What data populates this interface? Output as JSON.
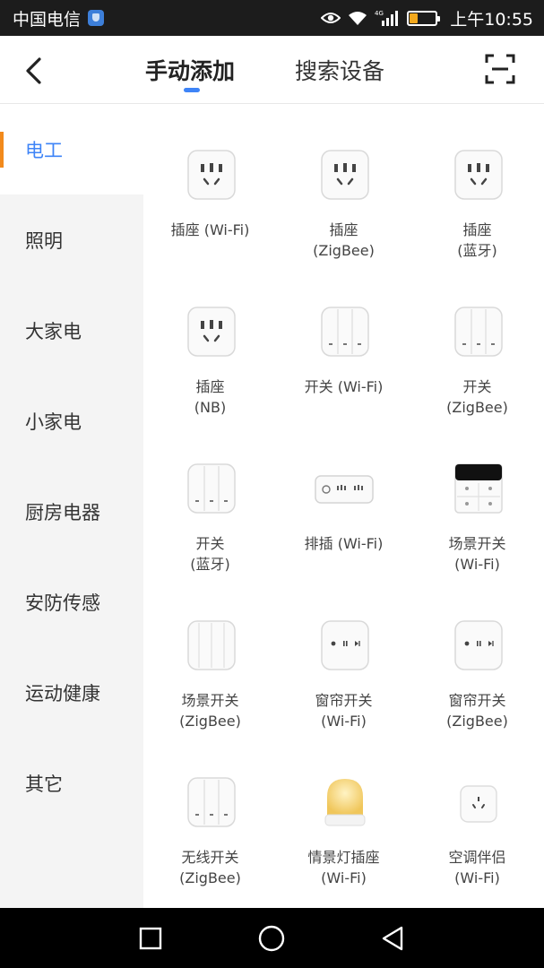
{
  "status_bar": {
    "carrier": "中国电信",
    "network": "4G",
    "time": "上午10:55",
    "battery_level": 0.3,
    "battery_color": "#f2a81d"
  },
  "header": {
    "tabs": [
      {
        "label": "手动添加",
        "active": true
      },
      {
        "label": "搜索设备",
        "active": false
      }
    ],
    "accent": "#3e84f7",
    "back_icon": "back-arrow-icon",
    "scan_icon": "scan-icon"
  },
  "sidebar": {
    "items": [
      {
        "label": "电工",
        "active": true
      },
      {
        "label": "照明"
      },
      {
        "label": "大家电"
      },
      {
        "label": "小家电"
      },
      {
        "label": "厨房电器"
      },
      {
        "label": "安防传感"
      },
      {
        "label": "运动健康"
      },
      {
        "label": "其它"
      }
    ],
    "active_color": "#3e84f7",
    "marker_color": "#f28a1c"
  },
  "devices": [
    {
      "line1": "插座 (Wi-Fi)",
      "line2": "",
      "icon": "socket-icon"
    },
    {
      "line1": "插座",
      "line2": "(ZigBee)",
      "icon": "socket-icon"
    },
    {
      "line1": "插座",
      "line2": "(蓝牙)",
      "icon": "socket-icon"
    },
    {
      "line1": "插座",
      "line2": "(NB)",
      "icon": "socket-icon"
    },
    {
      "line1": "开关 (Wi-Fi)",
      "line2": "",
      "icon": "switch-icon"
    },
    {
      "line1": "开关",
      "line2": "(ZigBee)",
      "icon": "switch-icon"
    },
    {
      "line1": "开关",
      "line2": "(蓝牙)",
      "icon": "switch-icon"
    },
    {
      "line1": "排插 (Wi-Fi)",
      "line2": "",
      "icon": "power-strip-icon"
    },
    {
      "line1": "场景开关",
      "line2": "(Wi-Fi)",
      "icon": "scene-switch-icon"
    },
    {
      "line1": "场景开关",
      "line2": "(ZigBee)",
      "icon": "scene-switch-panel-icon"
    },
    {
      "line1": "窗帘开关",
      "line2": "(Wi-Fi)",
      "icon": "curtain-switch-icon"
    },
    {
      "line1": "窗帘开关",
      "line2": "(ZigBee)",
      "icon": "curtain-switch-icon"
    },
    {
      "line1": "无线开关",
      "line2": "(ZigBee)",
      "icon": "switch-icon"
    },
    {
      "line1": "情景灯插座",
      "line2": "(Wi-Fi)",
      "icon": "night-light-icon"
    },
    {
      "line1": "空调伴侣",
      "line2": "(Wi-Fi)",
      "icon": "ac-companion-icon"
    }
  ],
  "nav_bar": {
    "buttons": [
      "recent-apps-icon",
      "home-icon",
      "back-triangle-icon"
    ]
  }
}
